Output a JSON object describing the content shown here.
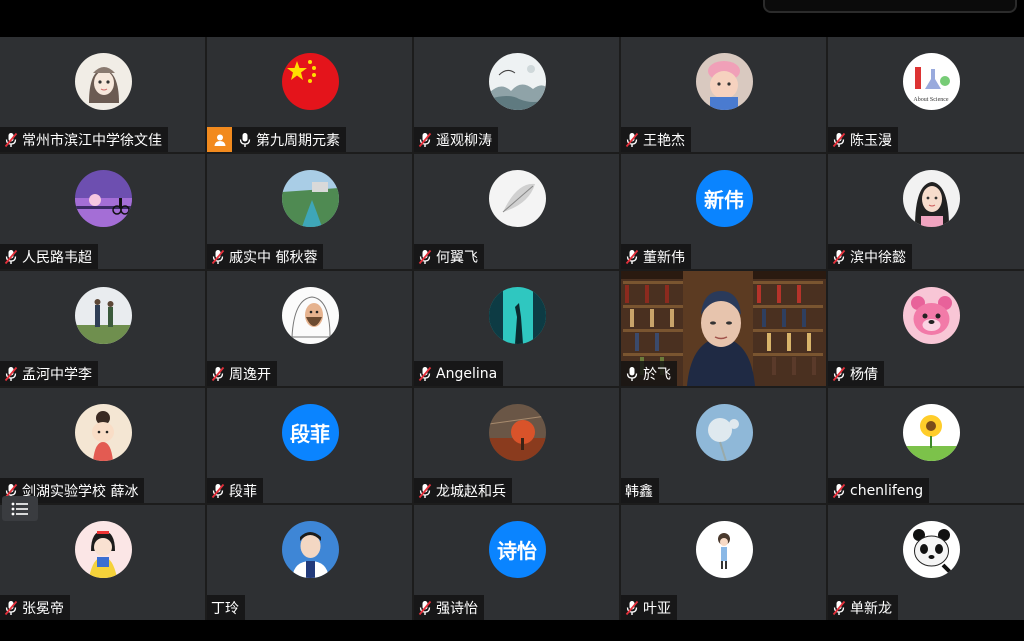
{
  "participants": [
    {
      "name": "常州市滨江中学徐文佳",
      "mic": "muted",
      "avatar": "girl-sketch-avatar"
    },
    {
      "name": "第九周期元素",
      "mic": "on",
      "avatar": "china-flag-avatar",
      "user_icon": true
    },
    {
      "name": "遥观柳涛",
      "mic": "muted",
      "avatar": "ink-landscape-avatar"
    },
    {
      "name": "王艳杰",
      "mic": "muted",
      "avatar": "baby-photo-avatar"
    },
    {
      "name": "陈玉漫",
      "mic": "muted",
      "avatar": "about-science-avatar"
    },
    {
      "name": "人民路韦超",
      "mic": "muted",
      "avatar": "sunset-cyclist-avatar"
    },
    {
      "name": "戚实中 郁秋蓉",
      "mic": "muted",
      "avatar": "river-landscape-avatar"
    },
    {
      "name": "何翼飞",
      "mic": "muted",
      "avatar": "feather-avatar"
    },
    {
      "name": "董新伟",
      "mic": "muted",
      "avatar_text": "新伟"
    },
    {
      "name": "滨中徐懿",
      "mic": "muted",
      "avatar": "woman-photo-avatar"
    },
    {
      "name": "孟河中学李",
      "mic": "muted",
      "avatar": "couple-field-avatar"
    },
    {
      "name": "周逸开",
      "mic": "muted",
      "avatar": "portrait-drawing-avatar"
    },
    {
      "name": "Angelina",
      "mic": "muted",
      "avatar": "teal-silhouette-avatar"
    },
    {
      "name": "於飞",
      "mic": "on",
      "video": true
    },
    {
      "name": "杨倩",
      "mic": "muted",
      "avatar": "pink-bear-avatar"
    },
    {
      "name": "剑湖实验学校 薛冰",
      "mic": "muted",
      "avatar": "cartoon-girl-avatar"
    },
    {
      "name": "段菲",
      "mic": "muted",
      "avatar_text": "段菲"
    },
    {
      "name": "龙城赵和兵",
      "mic": "muted",
      "avatar": "autumn-tree-avatar"
    },
    {
      "name": "韩鑫",
      "mic": "none",
      "avatar": "dandelion-avatar"
    },
    {
      "name": "chenlifeng",
      "mic": "muted",
      "avatar": "sunflower-avatar"
    },
    {
      "name": "张冕帝",
      "mic": "muted",
      "avatar": "snow-white-avatar"
    },
    {
      "name": "丁玲",
      "mic": "none",
      "avatar": "boy-id-photo-avatar"
    },
    {
      "name": "强诗怡",
      "mic": "muted",
      "avatar_text": "诗怡"
    },
    {
      "name": "叶亚",
      "mic": "muted",
      "avatar": "cartoon-figure-avatar"
    },
    {
      "name": "单新龙",
      "mic": "muted",
      "avatar": "panda-avatar"
    }
  ],
  "colors": {
    "tile_bg": "#2e3033",
    "initials_bg": "#0a84ff",
    "user_icon_bg": "#f28a1e",
    "muted_red": "#e5303b"
  }
}
